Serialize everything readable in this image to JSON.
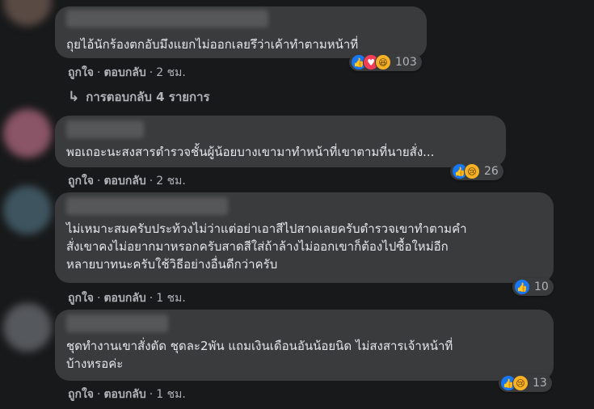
{
  "comments": [
    {
      "text": "ถุยไอ้นักร้องตกอับมึงแยกไม่ออกเลยรึว่าเค้าทำตามหน้าที่",
      "reaction_count": "103",
      "reaction_icons": [
        "like-icon",
        "love-icon",
        "haha-icon"
      ],
      "like_label": "ถูกใจ",
      "reply_label": "ตอบกลับ",
      "time": "2 ชม."
    },
    {
      "text": "พอเถอะนะสงสารตำรวจชั้นผู้น้อยบางเขามาทำหน้าที่เขาตามที่นายสั่ง...",
      "reaction_count": "26",
      "reaction_icons": [
        "like-icon",
        "sad-icon"
      ],
      "like_label": "ถูกใจ",
      "reply_label": "ตอบกลับ",
      "time": "2 ชม."
    },
    {
      "text": "ไม่เหมาะสมครับประท้วงไม่ว่าแต่อย่าเอาสีไปสาดเลยครับตำรวจเขาทำตามคำ\nสั่งเขาคงไม่อยากมาหรอกครับสาดสีใส่ถ้าล้างไม่ออกเขาก็ต้องไปซื้อใหม่อีก\nหลายบาทนะครับใช้วิธีอย่างอื่นดีกว่าครับ",
      "reaction_count": "10",
      "reaction_icons": [
        "like-icon"
      ],
      "like_label": "ถูกใจ",
      "reply_label": "ตอบกลับ",
      "time": "1 ชม."
    },
    {
      "text": "ชุดทำงานเขาสั่งตัด ชุดละ2พัน แถมเงินเดือนอันน้อยนิด ไม่สงสารเจ้าหน้าที่\nบ้างหรอค่ะ",
      "reaction_count": "13",
      "reaction_icons": [
        "like-icon",
        "sad-icon"
      ],
      "like_label": "ถูกใจ",
      "reply_label": "ตอบกลับ",
      "time": "1 ชม."
    }
  ],
  "replies_link": "การตอบกลับ 4 รายการ",
  "colors": {
    "background": "#18191a",
    "bubble": "#3a3b3c",
    "text": "#e4e6eb",
    "secondary": "#b0b3b8",
    "like": "#1877f2"
  }
}
